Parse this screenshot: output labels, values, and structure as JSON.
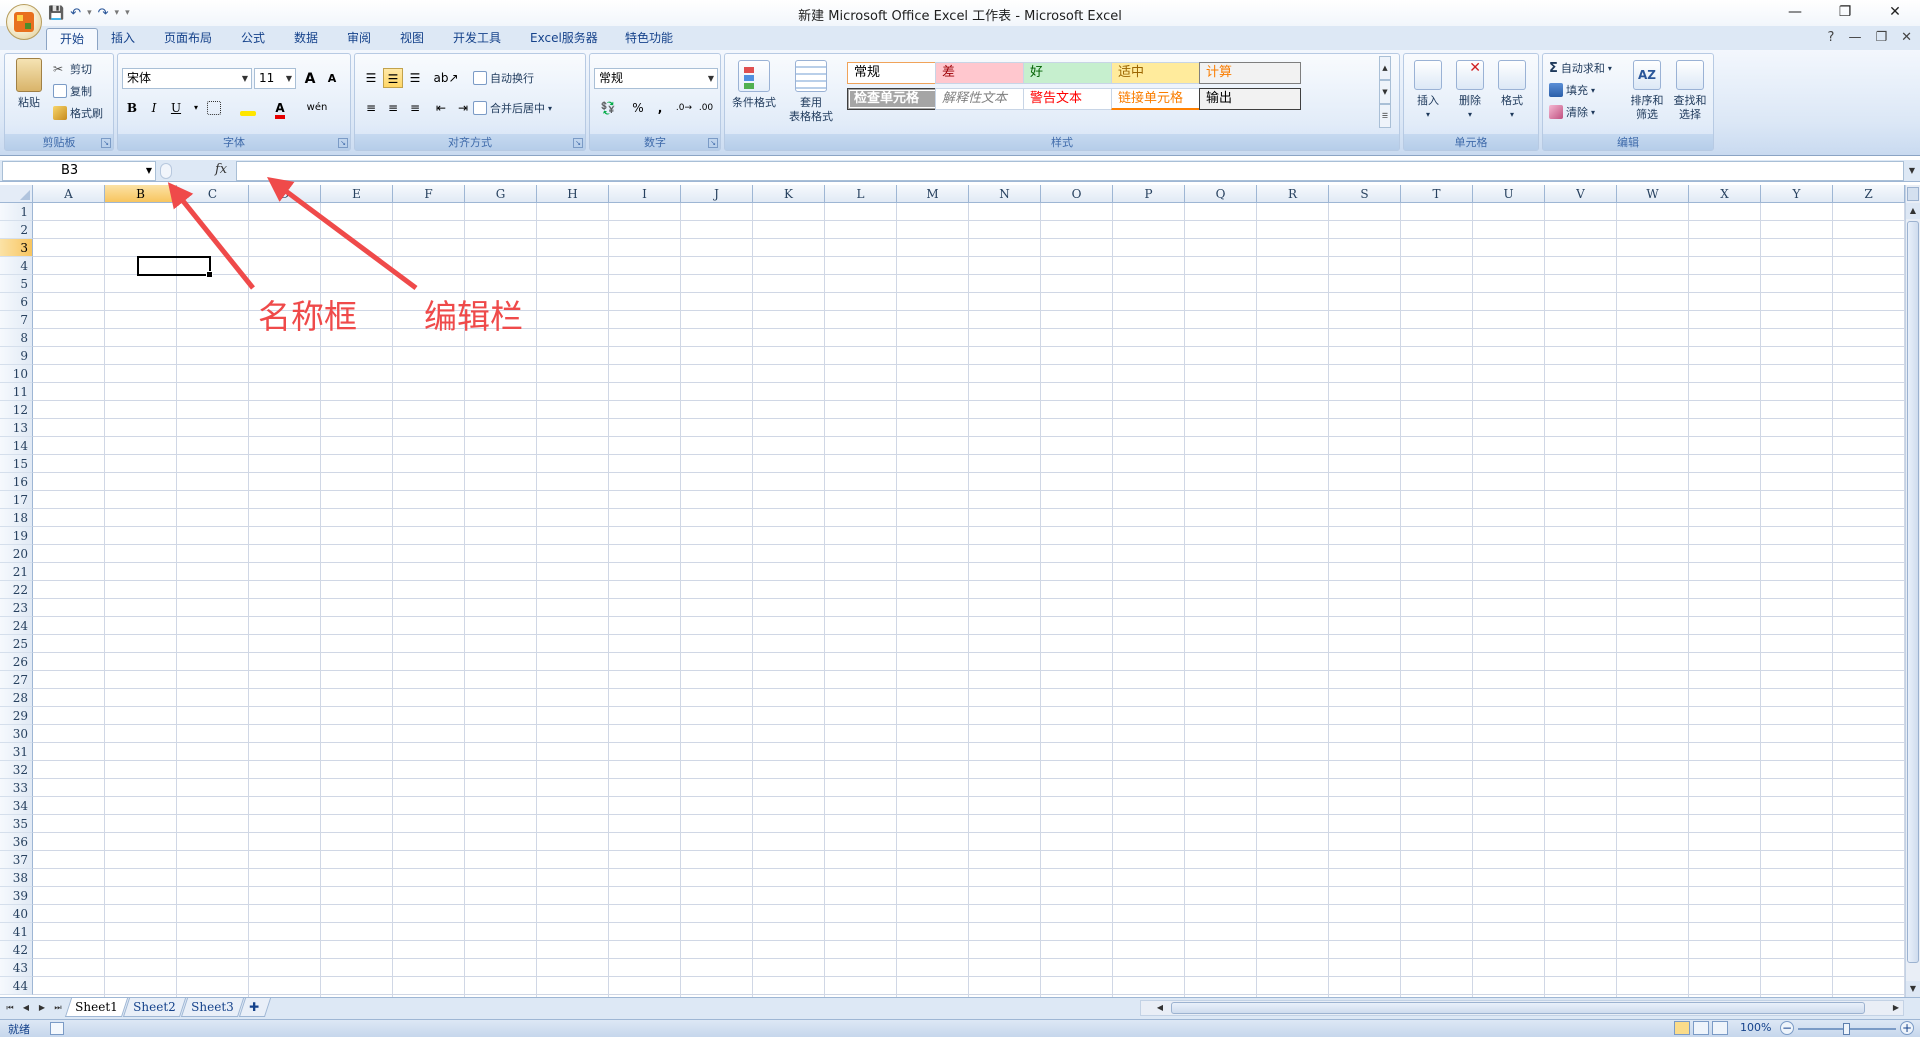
{
  "window": {
    "title": "新建 Microsoft Office Excel 工作表 - Microsoft Excel",
    "controls": [
      "—",
      "❐",
      "✕"
    ]
  },
  "quick_access": {
    "save_icon": "save-icon",
    "undo_icon": "undo-icon",
    "redo_icon": "redo-icon"
  },
  "tabs": [
    {
      "label": "开始",
      "active": true
    },
    {
      "label": "插入"
    },
    {
      "label": "页面布局"
    },
    {
      "label": "公式"
    },
    {
      "label": "数据"
    },
    {
      "label": "审阅"
    },
    {
      "label": "视图"
    },
    {
      "label": "开发工具"
    },
    {
      "label": "Excel服务器"
    },
    {
      "label": "特色功能"
    }
  ],
  "ribbon_right": {
    "help": "?",
    "minimize": "—",
    "restore": "❐",
    "close": "✕"
  },
  "clipboard": {
    "paste": "粘贴",
    "cut": "剪切",
    "copy": "复制",
    "format_painter": "格式刷",
    "group": "剪贴板"
  },
  "font": {
    "font_name": "宋体",
    "font_size": "11",
    "grow": "A",
    "shrink": "A",
    "bold": "B",
    "italic": "I",
    "underline": "U",
    "font_color_letter": "A",
    "phonetic": "wén",
    "group": "字体"
  },
  "alignment": {
    "wrap_text": "自动换行",
    "merge_center": "合并后居中",
    "group": "对齐方式"
  },
  "number": {
    "format": "常规",
    "percent": "%",
    "comma": ",",
    "group": "数字"
  },
  "styles": {
    "conditional_format": "条件格式",
    "table_format_1": "套用",
    "table_format_2": "表格格式",
    "cells": [
      {
        "label": "常规",
        "bg": "#ffffff",
        "color": "#000000",
        "border": "#f0a35a"
      },
      {
        "label": "差",
        "bg": "#ffc7ce",
        "color": "#9c0006"
      },
      {
        "label": "好",
        "bg": "#c6efce",
        "color": "#006100"
      },
      {
        "label": "适中",
        "bg": "#ffeb9c",
        "color": "#9c6500"
      },
      {
        "label": "计算",
        "bg": "#f2f2f2",
        "color": "#fa7d00",
        "border": "#7f7f7f"
      },
      {
        "label": "检查单元格",
        "bg": "#a5a5a5",
        "color": "#ffffff",
        "border": "#3f3f3f"
      },
      {
        "label": "解释性文本",
        "bg": "#ffffff",
        "color": "#7f7f7f",
        "italic": true
      },
      {
        "label": "警告文本",
        "bg": "#ffffff",
        "color": "#ff0000"
      },
      {
        "label": "链接单元格",
        "bg": "#ffffff",
        "color": "#fa7d00",
        "underline": "#ff8001"
      },
      {
        "label": "输出",
        "bg": "#f2f2f2",
        "color": "#000000",
        "border": "#3f3f3f"
      }
    ],
    "group": "样式"
  },
  "cells_group": {
    "insert": "插入",
    "delete": "删除",
    "format": "格式",
    "group": "单元格"
  },
  "editing": {
    "autosum": "自动求和",
    "fill": "填充",
    "clear": "清除",
    "sort_filter_1": "排序和",
    "sort_filter_2": "筛选",
    "find_select_1": "查找和",
    "find_select_2": "选择",
    "group": "编辑"
  },
  "formula_bar": {
    "name_box": "B3",
    "fx": "fx",
    "formula": ""
  },
  "grid": {
    "columns": [
      "A",
      "B",
      "C",
      "D",
      "E",
      "F",
      "G",
      "H",
      "I",
      "J",
      "K",
      "L",
      "M",
      "N",
      "O",
      "P",
      "Q",
      "R",
      "S",
      "T",
      "U",
      "V",
      "W",
      "X",
      "Y",
      "Z"
    ],
    "rows": [
      "1",
      "2",
      "3",
      "4",
      "5",
      "6",
      "7",
      "8",
      "9",
      "10",
      "11",
      "12",
      "13",
      "14",
      "15",
      "16",
      "17",
      "18",
      "19",
      "20",
      "21",
      "22",
      "23",
      "24",
      "25",
      "26",
      "27",
      "28",
      "29",
      "30",
      "31",
      "32",
      "33",
      "34",
      "35",
      "36",
      "37",
      "38",
      "39",
      "40",
      "41",
      "42",
      "43",
      "44"
    ],
    "selected_column": "B",
    "selected_row": "3"
  },
  "sheets": [
    {
      "label": "Sheet1",
      "active": true
    },
    {
      "label": "Sheet2"
    },
    {
      "label": "Sheet3"
    }
  ],
  "status": {
    "text": "就绪",
    "zoom": "100%",
    "zoom_minus": "−",
    "zoom_plus": "+"
  },
  "annotations": {
    "name_box_label": "名称框",
    "formula_bar_label": "编辑栏",
    "color": "#ef4a4a"
  }
}
